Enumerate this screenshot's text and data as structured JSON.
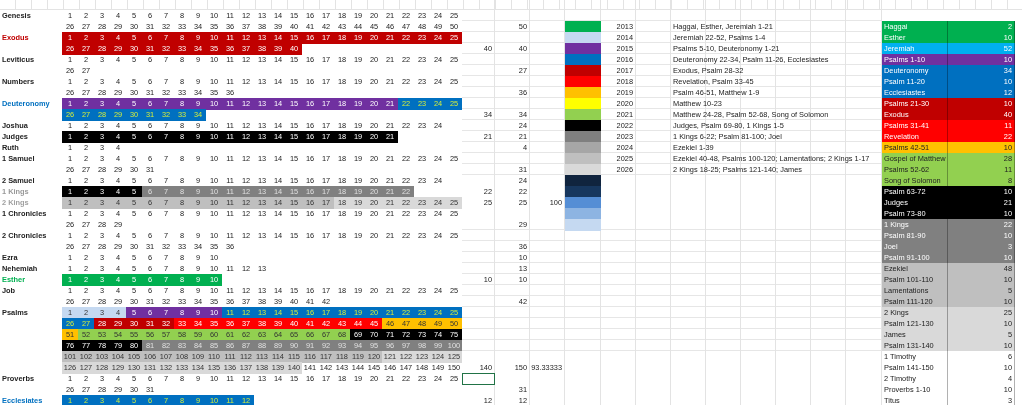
{
  "rows": [
    {
      "book": {
        "name": "Genesis"
      },
      "segments": [
        {
          "cells": [
            "1",
            "2",
            "3",
            "4",
            "5",
            "6",
            "7",
            "8",
            "9",
            "10",
            "11",
            "12",
            "13",
            "14",
            "15",
            "16",
            "17",
            "18",
            "19",
            "20",
            "21",
            "22",
            "23",
            "24",
            "25"
          ]
        }
      ]
    },
    {
      "segments": [
        {
          "cells": [
            "26",
            "27",
            "28",
            "29",
            "30",
            "31",
            "32",
            "33",
            "34",
            "35",
            "36",
            "37",
            "38",
            "39",
            "40",
            "41",
            "42",
            "43",
            "44",
            "45",
            "46",
            "47",
            "48",
            "49",
            "50"
          ]
        }
      ],
      "count": "50",
      "swatch": {
        "color": "#00b050"
      },
      "year": "2013",
      "reading": "Haggai, Esther, Jeremiah 1-21",
      "tally": {
        "name": "Haggai",
        "count": "2",
        "color": "#00b050"
      }
    },
    {
      "book": {
        "name": "Exodus",
        "color": "#c00000"
      },
      "segments": [
        {
          "color": "#c00000",
          "cells": [
            "1",
            "2",
            "3",
            "4",
            "5",
            "6",
            "7",
            "8",
            "9",
            "10",
            "11",
            "12",
            "13",
            "14",
            "15",
            "16",
            "17",
            "18",
            "19",
            "20",
            "21",
            "22",
            "23",
            "24",
            "25"
          ]
        }
      ],
      "swatch": {
        "color": "#c5d9f1"
      },
      "year": "2014",
      "reading": "Jeremiah 22-52, Psalms 1-4",
      "tally": {
        "name": "Esther",
        "count": "10",
        "color": "#00b050"
      }
    },
    {
      "segments": [
        {
          "color": "#c00000",
          "cells": [
            "26",
            "27",
            "28",
            "29",
            "30",
            "31",
            "32",
            "33",
            "34",
            "35",
            "36",
            "37",
            "38",
            "39",
            "40"
          ]
        }
      ],
      "total": "40",
      "count": "40",
      "swatch": {
        "color": "#7030a0"
      },
      "year": "2015",
      "reading": "Psalms 5-10, Deuteronomy 1-21",
      "tally": {
        "name": "Jeremiah",
        "count": "52",
        "color": "#00b0f0"
      }
    },
    {
      "book": {
        "name": "Leviticus"
      },
      "segments": [
        {
          "cells": [
            "1",
            "2",
            "3",
            "4",
            "5",
            "6",
            "7",
            "8",
            "9",
            "10",
            "11",
            "12",
            "13",
            "14",
            "15",
            "16",
            "17",
            "18",
            "19",
            "20",
            "21",
            "22",
            "23",
            "24",
            "25"
          ]
        }
      ],
      "swatch": {
        "color": "#0070c0"
      },
      "year": "2016",
      "reading": "Deuteronomy 22-34, Psalm 11-26, Ecclesiastes",
      "tally": {
        "name": "Psalms 1-10",
        "count": "10",
        "color": "#7030a0"
      }
    },
    {
      "segments": [
        {
          "cells": [
            "26",
            "27"
          ]
        }
      ],
      "count": "27",
      "swatch": {
        "color": "#c00000"
      },
      "year": "2017",
      "reading": "Exodus, Psalm 28-32",
      "tally": {
        "name": "Deuteronomy",
        "count": "34",
        "color": "#0070c0"
      }
    },
    {
      "book": {
        "name": "Numbers"
      },
      "segments": [
        {
          "cells": [
            "1",
            "2",
            "3",
            "4",
            "5",
            "6",
            "7",
            "8",
            "9",
            "10",
            "11",
            "12",
            "13",
            "14",
            "15",
            "16",
            "17",
            "18",
            "19",
            "20",
            "21",
            "22",
            "23",
            "24",
            "25"
          ]
        }
      ],
      "swatch": {
        "color": "#ff0000"
      },
      "year": "2018",
      "reading": "Revelation, Psalm 33-45",
      "tally": {
        "name": "Psalm 11-20",
        "count": "10",
        "color": "#0070c0"
      }
    },
    {
      "segments": [
        {
          "cells": [
            "26",
            "27",
            "28",
            "29",
            "30",
            "31",
            "32",
            "33",
            "34",
            "35",
            "36"
          ]
        }
      ],
      "count": "36",
      "swatch": {
        "color": "#ffc000"
      },
      "year": "2019",
      "reading": "Psalm 46-51, Matthew 1-9",
      "tally": {
        "name": "Ecclesiastes",
        "count": "12",
        "color": "#0070c0"
      }
    },
    {
      "book": {
        "name": "Deuteronomy",
        "color": "#0070c0"
      },
      "segments": [
        {
          "color": "#7030a0",
          "cells": [
            "1",
            "2",
            "3",
            "4",
            "5",
            "6",
            "7",
            "8",
            "9",
            "10",
            "11",
            "12",
            "13",
            "14",
            "15",
            "16",
            "17",
            "18",
            "19",
            "20",
            "21"
          ]
        },
        {
          "color": "#0070c0",
          "cells": [
            "22",
            "23",
            "24",
            "25"
          ]
        }
      ],
      "swatch": {
        "color": "#ffff00"
      },
      "year": "2020",
      "reading": "Matthew 10-23",
      "tally": {
        "name": "Psalms 21-30",
        "count": "10",
        "color": "#c00000"
      }
    },
    {
      "segments": [
        {
          "color": "#0070c0",
          "cells": [
            "26",
            "27",
            "28",
            "29",
            "30",
            "31",
            "32",
            "33",
            "34"
          ]
        }
      ],
      "total": "34",
      "count": "34",
      "swatch": {
        "color": "#92d050"
      },
      "year": "2021",
      "reading": "Matthew 24-28, Psalm 52-68, Song of Solomon",
      "tally": {
        "name": "Exodus",
        "count": "40",
        "color": "#c00000"
      }
    },
    {
      "book": {
        "name": "Joshua"
      },
      "segments": [
        {
          "cells": [
            "1",
            "2",
            "3",
            "4",
            "5",
            "6",
            "7",
            "8",
            "9",
            "10",
            "11",
            "12",
            "13",
            "14",
            "15",
            "16",
            "17",
            "18",
            "19",
            "20",
            "21",
            "22",
            "23",
            "24"
          ]
        }
      ],
      "count": "24",
      "swatch": {
        "color": "#000000"
      },
      "year": "2022",
      "reading": "Judges, Psalm 69-80, 1 Kings 1-5",
      "tally": {
        "name": "Psalms 31-41",
        "count": "11",
        "color": "#ff0000"
      }
    },
    {
      "book": {
        "name": "Judges"
      },
      "segments": [
        {
          "color": "#000000",
          "cells": [
            "1",
            "2",
            "3",
            "4",
            "5",
            "6",
            "7",
            "8",
            "9",
            "10",
            "11",
            "12",
            "13",
            "14",
            "15",
            "16",
            "17",
            "18",
            "19",
            "20",
            "21"
          ]
        }
      ],
      "total": "21",
      "count": "21",
      "swatch": {
        "color": "#7f7f7f"
      },
      "year": "2023",
      "reading": "1 Kings 6-22; Psalm 81-100; Joel",
      "tally": {
        "name": "Revelation",
        "count": "22",
        "color": "#ff0000"
      }
    },
    {
      "book": {
        "name": "Ruth"
      },
      "segments": [
        {
          "cells": [
            "1",
            "2",
            "3",
            "4"
          ]
        }
      ],
      "count": "4",
      "swatch": {
        "color": "#a6a6a6"
      },
      "year": "2024",
      "reading": "Ezekiel 1-39",
      "tally": {
        "name": "Psalms 42-51",
        "count": "10",
        "color": "#ffc000"
      }
    },
    {
      "book": {
        "name": "1 Samuel"
      },
      "segments": [
        {
          "cells": [
            "1",
            "2",
            "3",
            "4",
            "5",
            "6",
            "7",
            "8",
            "9",
            "10",
            "11",
            "12",
            "13",
            "14",
            "15",
            "16",
            "17",
            "18",
            "19",
            "20",
            "21",
            "22",
            "23",
            "24",
            "25"
          ]
        }
      ],
      "swatch": {
        "color": "#bfbfbf"
      },
      "year": "2025",
      "reading": "Ezekiel 40-48, Psalms 100-120; Lamentations; 2 Kings 1-17",
      "tally": {
        "name": "Gospel of Matthew",
        "count": "28",
        "color": "#92d050"
      }
    },
    {
      "segments": [
        {
          "cells": [
            "26",
            "27",
            "28",
            "29",
            "30",
            "31"
          ]
        }
      ],
      "count": "31",
      "swatch": {
        "color": "#d9d9d9"
      },
      "year": "2026",
      "reading": "2 Kings 18-25; Psalms 121-140; James",
      "tally": {
        "name": "Psalms 52-62",
        "count": "11",
        "color": "#92d050"
      }
    },
    {
      "book": {
        "name": "2 Samuel"
      },
      "segments": [
        {
          "cells": [
            "1",
            "2",
            "3",
            "4",
            "5",
            "6",
            "7",
            "8",
            "9",
            "10",
            "11",
            "12",
            "13",
            "14",
            "15",
            "16",
            "17",
            "18",
            "19",
            "20",
            "21",
            "22",
            "23",
            "24"
          ]
        }
      ],
      "count": "24",
      "swatch": {
        "color": "#10243e"
      },
      "tally": {
        "name": "Song of Solomon",
        "count": "8",
        "color": "#92d050"
      }
    },
    {
      "book": {
        "name": "1 Kings",
        "color": "#999999"
      },
      "segments": [
        {
          "color": "#000000",
          "cells": [
            "1",
            "2",
            "3",
            "4",
            "5"
          ]
        },
        {
          "color": "#808080",
          "cells": [
            "6",
            "7",
            "8",
            "9",
            "10",
            "11",
            "12",
            "13",
            "14",
            "15",
            "16",
            "17",
            "18",
            "19",
            "20",
            "21",
            "22"
          ]
        }
      ],
      "total": "22",
      "count": "22",
      "swatch": {
        "color": "#17375e"
      },
      "tally": {
        "name": "Psalm 63-72",
        "count": "10",
        "color": "#000000"
      }
    },
    {
      "book": {
        "name": "2 Kings",
        "color": "#a0a0a0"
      },
      "segments": [
        {
          "color": "#bfbfbf",
          "cells": [
            "1",
            "2",
            "3",
            "4",
            "5",
            "6",
            "7",
            "8",
            "9",
            "10",
            "11",
            "12",
            "13",
            "14",
            "15",
            "16",
            "17"
          ]
        },
        {
          "color": "#d9d9d9",
          "cells": [
            "18",
            "19",
            "20",
            "21",
            "22",
            "23",
            "24",
            "25"
          ]
        }
      ],
      "total": "25",
      "count": "25",
      "extra": "100",
      "swatch": {
        "color": "#558ed5"
      },
      "tally": {
        "name": "Judges",
        "count": "21",
        "color": "#000000"
      }
    },
    {
      "book": {
        "name": "1 Chronicles"
      },
      "segments": [
        {
          "cells": [
            "1",
            "2",
            "3",
            "4",
            "5",
            "6",
            "7",
            "8",
            "9",
            "10",
            "11",
            "12",
            "13",
            "14",
            "15",
            "16",
            "17",
            "18",
            "19",
            "20",
            "21",
            "22",
            "23",
            "24",
            "25"
          ]
        }
      ],
      "swatch": {
        "color": "#8db4e2"
      },
      "tally": {
        "name": "Psalm 73-80",
        "count": "10",
        "color": "#000000"
      }
    },
    {
      "segments": [
        {
          "cells": [
            "26",
            "27",
            "28",
            "29"
          ]
        }
      ],
      "count": "29",
      "swatch": {
        "color": "#c5d9f1"
      },
      "tally": {
        "name": "1 Kings",
        "count": "22",
        "color": "#808080"
      }
    },
    {
      "book": {
        "name": "2 Chronicles"
      },
      "segments": [
        {
          "cells": [
            "1",
            "2",
            "3",
            "4",
            "5",
            "6",
            "7",
            "8",
            "9",
            "10",
            "11",
            "12",
            "13",
            "14",
            "15",
            "16",
            "17",
            "18",
            "19",
            "20",
            "21",
            "22",
            "23",
            "24",
            "25"
          ]
        }
      ],
      "tally": {
        "name": "Psalm 81-90",
        "count": "10",
        "color": "#808080"
      }
    },
    {
      "segments": [
        {
          "cells": [
            "26",
            "27",
            "28",
            "29",
            "30",
            "31",
            "32",
            "33",
            "34",
            "35",
            "36"
          ]
        }
      ],
      "count": "36",
      "tally": {
        "name": "Joel",
        "count": "3",
        "color": "#808080"
      }
    },
    {
      "book": {
        "name": "Ezra"
      },
      "segments": [
        {
          "cells": [
            "1",
            "2",
            "3",
            "4",
            "5",
            "6",
            "7",
            "8",
            "9",
            "10"
          ]
        }
      ],
      "count": "10",
      "tally": {
        "name": "Psalm 91-100",
        "count": "10",
        "color": "#808080"
      }
    },
    {
      "book": {
        "name": "Nehemiah"
      },
      "segments": [
        {
          "cells": [
            "1",
            "2",
            "3",
            "4",
            "5",
            "6",
            "7",
            "8",
            "9",
            "10",
            "11",
            "12",
            "13"
          ]
        }
      ],
      "count": "13",
      "tally": {
        "name": "Ezekiel",
        "count": "48",
        "color": "#bfbfbf"
      }
    },
    {
      "book": {
        "name": "Esther",
        "color": "#00b050"
      },
      "segments": [
        {
          "color": "#00b050",
          "cells": [
            "1",
            "2",
            "3",
            "4",
            "5",
            "6",
            "7",
            "8",
            "9",
            "10"
          ]
        }
      ],
      "total": "10",
      "count": "10",
      "tally": {
        "name": "Psalm 101-110",
        "count": "10",
        "color": "#bfbfbf"
      }
    },
    {
      "book": {
        "name": "Job"
      },
      "segments": [
        {
          "cells": [
            "1",
            "2",
            "3",
            "4",
            "5",
            "6",
            "7",
            "8",
            "9",
            "10",
            "11",
            "12",
            "13",
            "14",
            "15",
            "16",
            "17",
            "18",
            "19",
            "20",
            "21",
            "22",
            "23",
            "24",
            "25"
          ]
        }
      ],
      "tally": {
        "name": "Lamentations",
        "count": "5",
        "color": "#bfbfbf"
      }
    },
    {
      "segments": [
        {
          "cells": [
            "26",
            "27",
            "28",
            "29",
            "30",
            "31",
            "32",
            "33",
            "34",
            "35",
            "36",
            "37",
            "38",
            "39",
            "40",
            "41",
            "42"
          ]
        }
      ],
      "count": "42",
      "tally": {
        "name": "Psalm 111-120",
        "count": "10",
        "color": "#bfbfbf"
      }
    },
    {
      "book": {
        "name": "Psalms"
      },
      "segments": [
        {
          "color": "#c5d9f1",
          "cells": [
            "1",
            "2",
            "3",
            "4"
          ]
        },
        {
          "color": "#7030a0",
          "cells": [
            "5",
            "6",
            "7",
            "8",
            "9",
            "10"
          ]
        },
        {
          "color": "#0070c0",
          "cells": [
            "11",
            "12",
            "13",
            "14",
            "15",
            "16",
            "17",
            "18",
            "19",
            "20",
            "21",
            "22",
            "23",
            "24",
            "25"
          ]
        }
      ],
      "tally": {
        "name": "2 Kings",
        "count": "25",
        "color": "#d9d9d9"
      }
    },
    {
      "segments": [
        {
          "color": "#0070c0",
          "cells": [
            "26",
            "27"
          ]
        },
        {
          "color": "#c00000",
          "cells": [
            "28",
            "29",
            "30",
            "31",
            "32"
          ]
        },
        {
          "color": "#ff0000",
          "cells": [
            "33",
            "34",
            "35",
            "36",
            "37",
            "38",
            "39",
            "40",
            "41",
            "42",
            "43",
            "44",
            "45"
          ]
        },
        {
          "color": "#ffc000",
          "cells": [
            "46",
            "47",
            "48",
            "49",
            "50"
          ]
        }
      ],
      "tally": {
        "name": "Psalm 121-130",
        "count": "10",
        "color": "#d9d9d9"
      }
    },
    {
      "segments": [
        {
          "color": "#ffc000",
          "cells": [
            "51"
          ]
        },
        {
          "color": "#92d050",
          "cells": [
            "52",
            "53",
            "54",
            "55",
            "56",
            "57",
            "58",
            "59",
            "60",
            "61",
            "62",
            "63",
            "64",
            "65",
            "66",
            "67",
            "68"
          ]
        },
        {
          "color": "#000000",
          "cells": [
            "69",
            "70",
            "71",
            "72",
            "73",
            "74",
            "75"
          ]
        }
      ],
      "tally": {
        "name": "James",
        "count": "5",
        "color": "#d9d9d9"
      }
    },
    {
      "segments": [
        {
          "color": "#000000",
          "cells": [
            "76",
            "77",
            "78",
            "79",
            "80"
          ]
        },
        {
          "color": "#808080",
          "cells": [
            "81",
            "82",
            "83",
            "84",
            "85",
            "86",
            "87",
            "88",
            "89",
            "90",
            "91",
            "92",
            "93",
            "94",
            "95",
            "96",
            "97",
            "98",
            "99",
            "100"
          ]
        }
      ],
      "tally": {
        "name": "Psalm 131-140",
        "count": "10",
        "color": "#d9d9d9"
      }
    },
    {
      "segments": [
        {
          "color": "#bfbfbf",
          "cells": [
            "101",
            "102",
            "103",
            "104",
            "105",
            "106",
            "107",
            "108",
            "109",
            "110",
            "111",
            "112",
            "113",
            "114",
            "115",
            "116",
            "117",
            "118",
            "119",
            "120"
          ]
        },
        {
          "color": "#d9d9d9",
          "cells": [
            "121",
            "122",
            "123",
            "124",
            "125"
          ]
        }
      ],
      "tally": {
        "name": "1 Timothy",
        "count": "6",
        "color": "#ffffff"
      }
    },
    {
      "segments": [
        {
          "color": "#d9d9d9",
          "cells": [
            "126",
            "127",
            "128",
            "129",
            "130",
            "131",
            "132",
            "133",
            "134",
            "135",
            "136",
            "137",
            "138",
            "139",
            "140"
          ]
        },
        {
          "cells": [
            "141",
            "142",
            "143",
            "144",
            "145",
            "146",
            "147",
            "148",
            "149",
            "150"
          ]
        }
      ],
      "total": "140",
      "count": "150",
      "extra": "93.33333",
      "tally": {
        "name": "Psalm 141-150",
        "count": "10",
        "color": "#ffffff"
      }
    },
    {
      "book": {
        "name": "Proverbs"
      },
      "segments": [
        {
          "cells": [
            "1",
            "2",
            "3",
            "4",
            "5",
            "6",
            "7",
            "8",
            "9",
            "10",
            "11",
            "12",
            "13",
            "14",
            "15",
            "16",
            "17",
            "18",
            "19",
            "20",
            "21",
            "22",
            "23",
            "24",
            "25"
          ]
        }
      ],
      "cursor": true,
      "tally": {
        "name": "2 Timothy",
        "count": "4",
        "color": "#ffffff"
      }
    },
    {
      "segments": [
        {
          "cells": [
            "26",
            "27",
            "28",
            "29",
            "30",
            "31"
          ]
        }
      ],
      "count": "31",
      "tally": {
        "name": "Proverbs 1-10",
        "count": "10",
        "color": "#ffffff"
      }
    },
    {
      "book": {
        "name": "Ecclesiates",
        "color": "#0070c0"
      },
      "segments": [
        {
          "color": "#0070c0",
          "cells": [
            "1",
            "2",
            "3",
            "4",
            "5",
            "6",
            "7",
            "8",
            "9",
            "10",
            "11",
            "12"
          ]
        }
      ],
      "total": "12",
      "count": "12",
      "tally": {
        "name": "Titus",
        "count": "3",
        "color": "#ffffff"
      }
    }
  ]
}
